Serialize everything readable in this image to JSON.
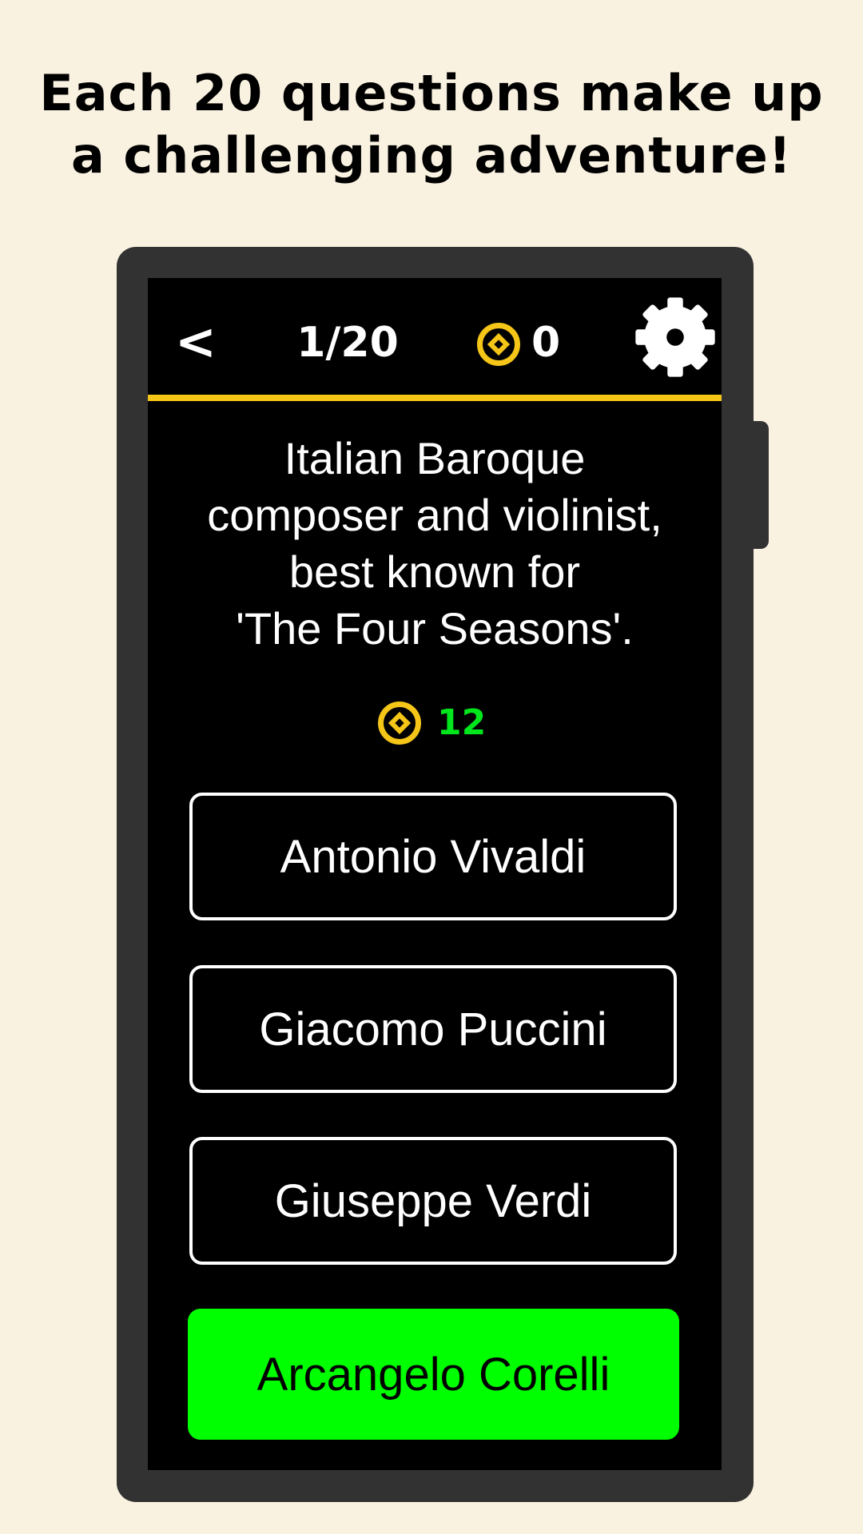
{
  "promo": {
    "line1": "Each 20 questions make up",
    "line2": "a challenging adventure!"
  },
  "topbar": {
    "back_label": "<",
    "progress": "1/20",
    "coins": "0",
    "settings_icon": "gear-icon",
    "accent_color": "#f5c518"
  },
  "question": {
    "line1": "Italian Baroque",
    "line2": "composer and violinist,",
    "line3": "best known for",
    "line4": "'The Four Seasons'.",
    "reward": "12",
    "reward_color": "#00e61c"
  },
  "answers": [
    {
      "label": "Antonio Vivaldi",
      "state": "default"
    },
    {
      "label": "Giacomo Puccini",
      "state": "default"
    },
    {
      "label": "Giuseppe Verdi",
      "state": "default"
    },
    {
      "label": "Arcangelo Corelli",
      "state": "highlighted",
      "color": "#00ff00"
    }
  ]
}
